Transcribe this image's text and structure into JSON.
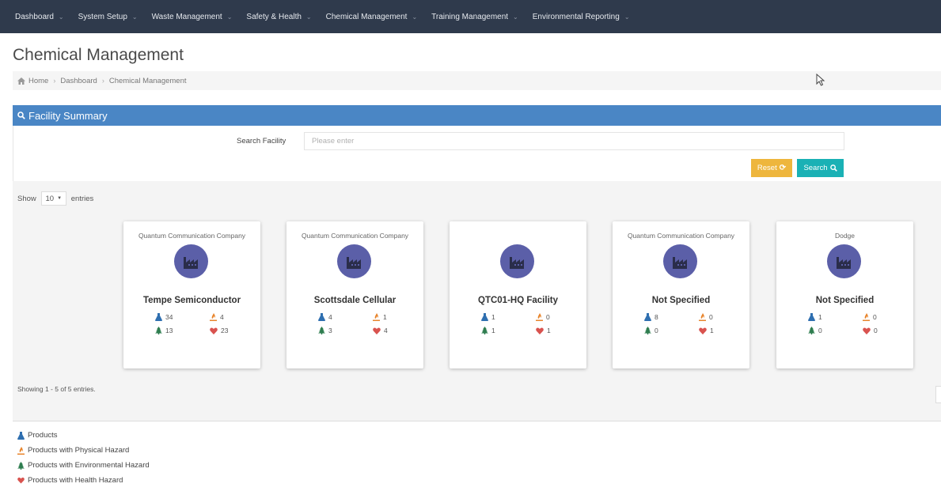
{
  "nav": {
    "items": [
      {
        "label": "Dashboard",
        "caret": "⌄"
      },
      {
        "label": "System Setup",
        "caret": "⌄"
      },
      {
        "label": "Waste Management",
        "caret": "⌄"
      },
      {
        "label": "Safety & Health",
        "caret": "⌄"
      },
      {
        "label": "Chemical Management",
        "caret": "⌄"
      },
      {
        "label": "Training Management",
        "caret": "⌄"
      },
      {
        "label": "Environmental Reporting",
        "caret": "⌄"
      }
    ]
  },
  "page": {
    "title": "Chemical Management",
    "breadcrumb": [
      "Home",
      "Dashboard",
      "Chemical Management"
    ],
    "breadcrumb_sep": "›"
  },
  "panel": {
    "title": "Facility Summary",
    "search_label": "Search Facility",
    "search_placeholder": "Please enter",
    "search_value": "",
    "reset_label": "Reset",
    "search_button_label": "Search"
  },
  "table": {
    "show_label": "Show",
    "entries_value": "10",
    "entries_label": "entries",
    "showing_text": "Showing 1 - 5 of 5 entries."
  },
  "cards": [
    {
      "company": "Quantum Communication Company",
      "name": "Tempe Semiconductor",
      "products": "34",
      "physical": "4",
      "environmental": "13",
      "health": "23"
    },
    {
      "company": "Quantum Communication Company",
      "name": "Scottsdale Cellular",
      "products": "4",
      "physical": "1",
      "environmental": "3",
      "health": "4"
    },
    {
      "company": "",
      "name": "QTC01-HQ Facility",
      "products": "1",
      "physical": "0",
      "environmental": "1",
      "health": "1"
    },
    {
      "company": "Quantum Communication Company",
      "name": "Not Specified",
      "products": "8",
      "physical": "0",
      "environmental": "0",
      "health": "1"
    },
    {
      "company": "Dodge",
      "name": "Not Specified",
      "products": "1",
      "physical": "0",
      "environmental": "0",
      "health": "0"
    }
  ],
  "legend": {
    "products": "Products",
    "physical": "Products with Physical Hazard",
    "environmental": "Products with Environmental Hazard",
    "health": "Products with Health Hazard"
  },
  "colors": {
    "nav_bg": "#2f3a4c",
    "panel_header": "#4a86c5",
    "reset_button": "#eeb63d",
    "search_button": "#1ab1b5",
    "facility_badge": "#5b5fa8",
    "flask_icon": "#2f6fb0",
    "flame_icon": "#e8852d",
    "tree_icon": "#2e7d4f",
    "heart_icon": "#d9534f"
  },
  "icons": {
    "products": "flask-icon",
    "physical": "flame-icon",
    "environmental": "tree-icon",
    "health": "heart-icon",
    "facility": "factory-icon"
  }
}
